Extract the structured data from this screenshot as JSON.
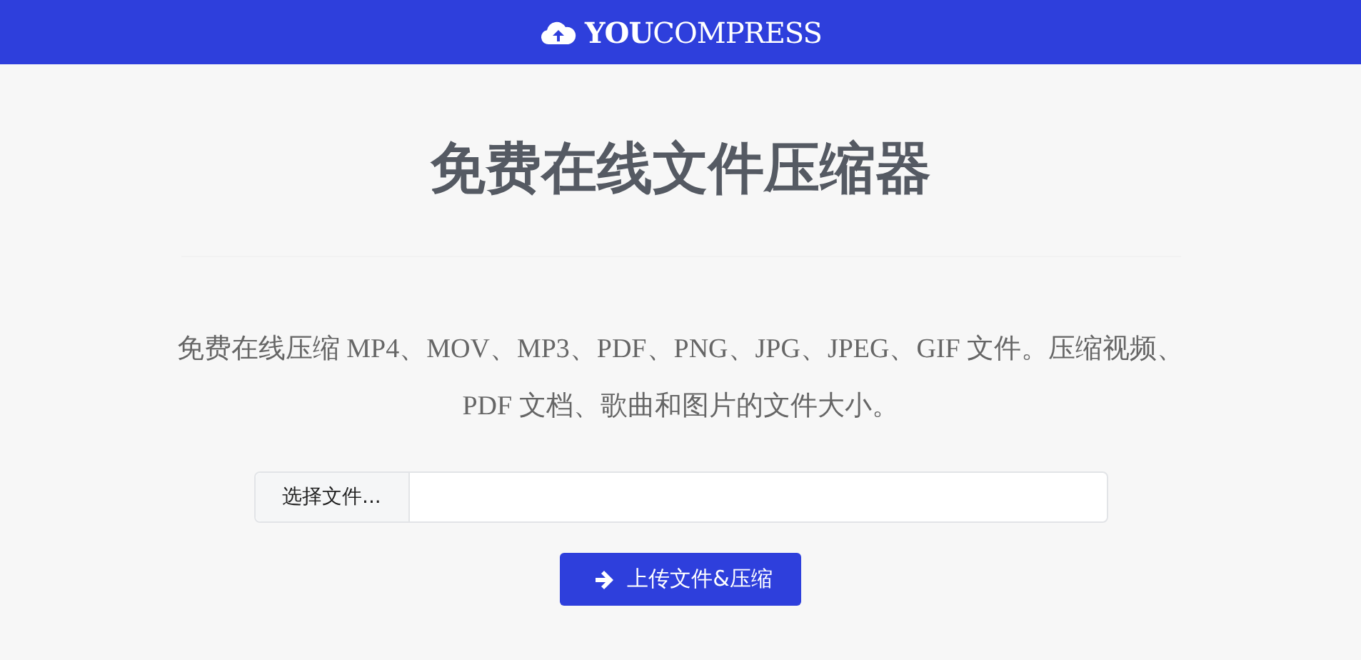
{
  "header": {
    "logo": "**YOU**COMPRESS"
  },
  "title": "免费在线文件压缩器",
  "description": "免费在线压缩 MP4、MOV、MP3、PDF、PNG、JPG、JPEG、GIF 文件。压缩视频、PDF 文档、歌曲和图片的文件大小。",
  "file_picker": {
    "button": "选择文件..."
  },
  "upload_button": {
    "label": "上传文件&压缩"
  }
}
